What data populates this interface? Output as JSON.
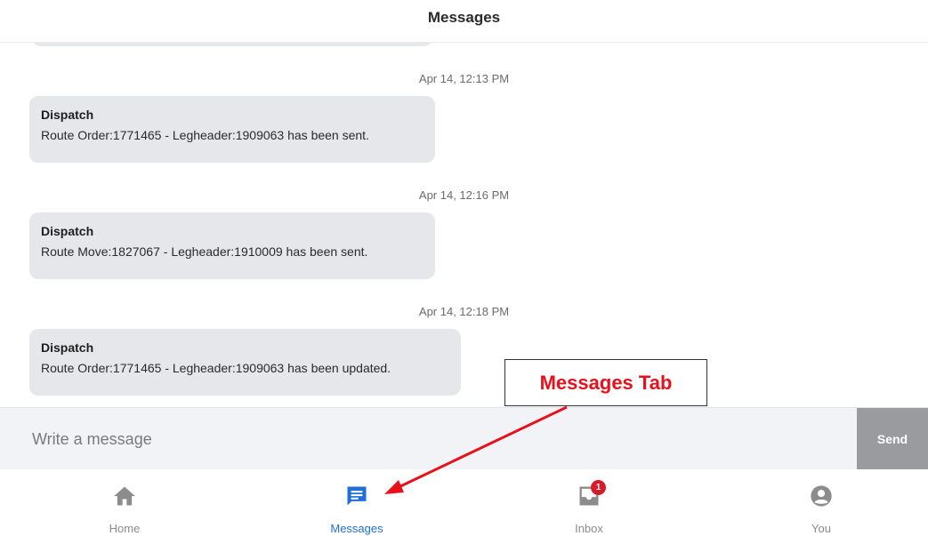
{
  "header": {
    "title": "Messages"
  },
  "messages": [
    {
      "timestamp": "Apr 14, 12:13 PM",
      "sender": "Dispatch",
      "text": "Route Order:1771465 - Legheader:1909063 has been sent."
    },
    {
      "timestamp": "Apr 14, 12:16 PM",
      "sender": "Dispatch",
      "text": "Route Move:1827067 - Legheader:1910009 has been sent."
    },
    {
      "timestamp": "Apr 14, 12:18 PM",
      "sender": "Dispatch",
      "text": "Route Order:1771465 - Legheader:1909063 has been updated."
    }
  ],
  "composer": {
    "placeholder": "Write a message",
    "send_label": "Send"
  },
  "tabs": [
    {
      "label": "Home",
      "icon": "home-icon",
      "active": false
    },
    {
      "label": "Messages",
      "icon": "chat-icon",
      "active": true
    },
    {
      "label": "Inbox",
      "icon": "inbox-icon",
      "active": false,
      "badge": "1"
    },
    {
      "label": "You",
      "icon": "user-icon",
      "active": false
    }
  ],
  "annotation": {
    "label": "Messages Tab",
    "color": "#e8101b"
  },
  "colors": {
    "active": "#1f6fd6",
    "inactive": "#8c8c8c",
    "bubble": "#e5e7eb",
    "badge": "#d81b2a"
  }
}
